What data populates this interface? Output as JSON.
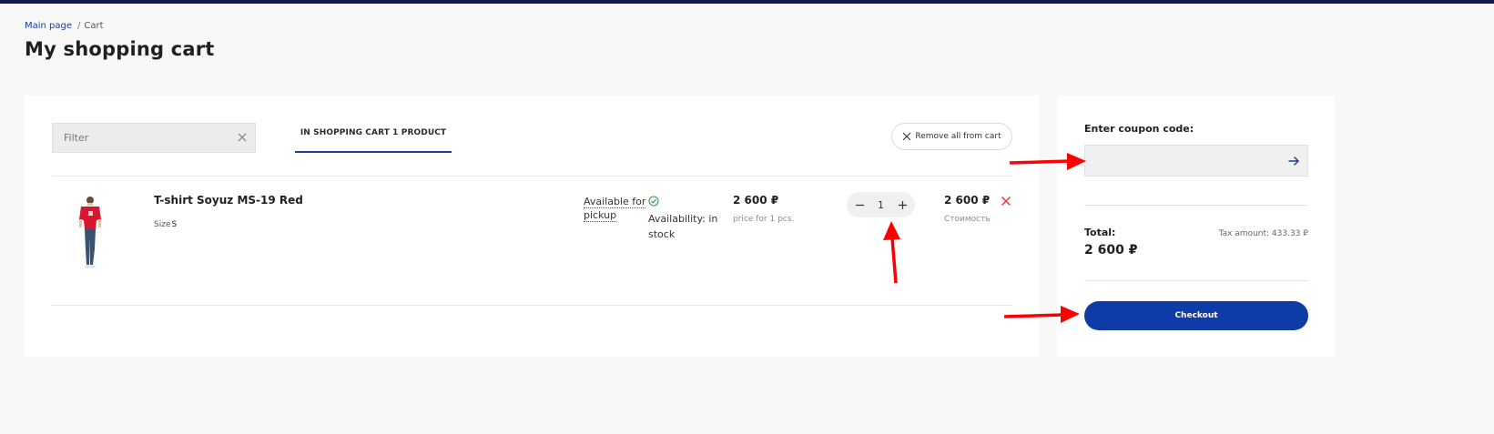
{
  "breadcrumb": {
    "home": "Main page",
    "separator": "/",
    "current": "Cart"
  },
  "page_title": "My shopping cart",
  "cart": {
    "filter_placeholder": "Filter",
    "tab_label": "IN SHOPPING CART 1 PRODUCT",
    "remove_all_label": "Remove all from cart",
    "items": [
      {
        "name": "T-shirt Soyuz MS-19 Red",
        "size_label": "Size",
        "size_value": "S",
        "pickup": "Available for pickup",
        "availability": "Availability: in stock",
        "price": "2 600 ₽",
        "price_note": "price for 1 pcs.",
        "quantity": "1",
        "total": "2 600 ₽",
        "total_note": "Стоимость"
      }
    ]
  },
  "summary": {
    "coupon_label": "Enter coupon code:",
    "coupon_value": "",
    "total_label": "Total:",
    "total_amount": "2 600 ₽",
    "tax": "Tax amount: 433.33 ₽",
    "checkout_label": "Checkout"
  },
  "colors": {
    "accent": "#0f3ba6",
    "topbar": "#0e1a4b",
    "delete": "#e53935",
    "in_stock": "#2e9e4f",
    "annotation_arrow": "#ff0000"
  }
}
